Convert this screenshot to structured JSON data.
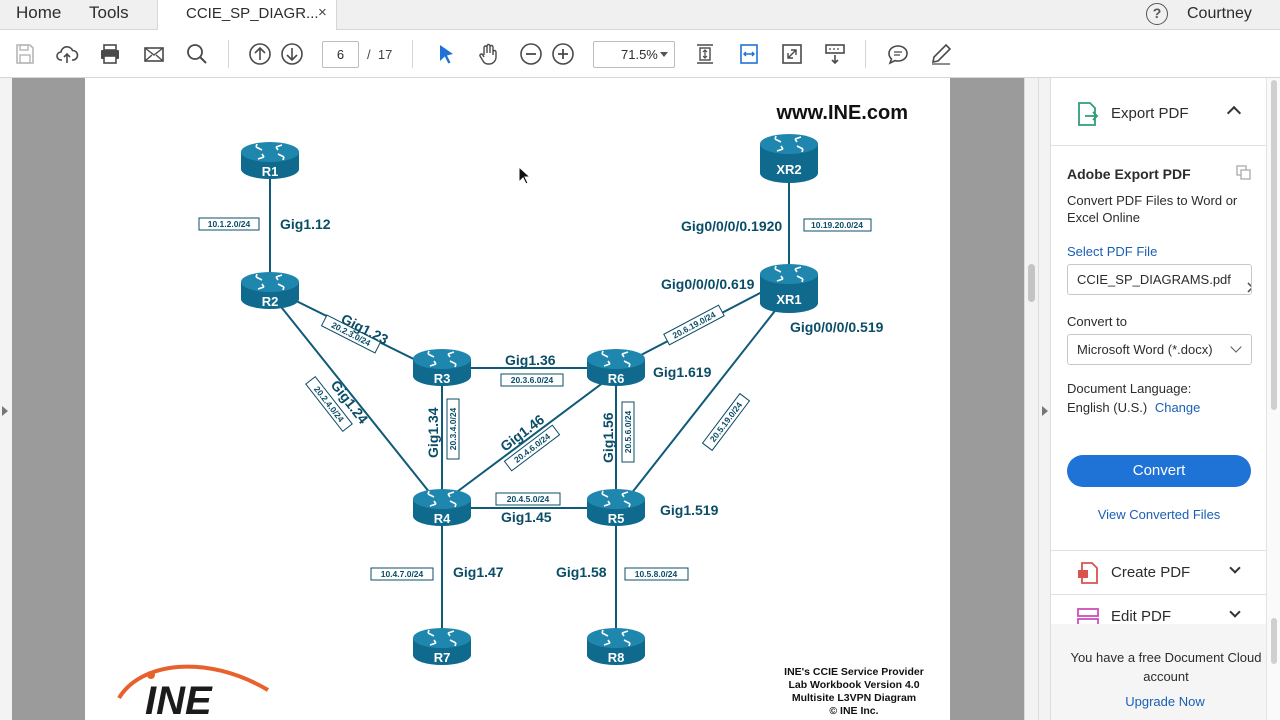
{
  "tabs": {
    "home": "Home",
    "tools": "Tools",
    "document": "CCIE_SP_DIAGR...",
    "close": "×"
  },
  "user": {
    "name": "Courtney",
    "help": "?"
  },
  "toolbar": {
    "page_current": "6",
    "page_separator": "/",
    "page_total": "17",
    "zoom": "71.5%"
  },
  "diagram": {
    "watermark": "www.INE.com",
    "routers": {
      "R1": "R1",
      "R2": "R2",
      "R3": "R3",
      "R4": "R4",
      "R5": "R5",
      "R6": "R6",
      "R7": "R7",
      "R8": "R8",
      "XR1": "XR1",
      "XR2": "XR2"
    },
    "interfaces": {
      "r1_r2": "Gig1.12",
      "r2_r3": "Gig1.23",
      "r2_r4": "Gig1.24",
      "r3_r6": "Gig1.36",
      "r3_r4": "Gig1.34",
      "r4_r6": "Gig1.46",
      "r6_r5": "Gig1.56",
      "r4_r5": "Gig1.45",
      "r4_r7": "Gig1.47",
      "r5_r8": "Gig1.58",
      "r6_xr1": "Gig1.619",
      "r5_xr1": "Gig1.519",
      "xr2_xr1": "Gig0/0/0/0.1920",
      "xr1_to_r6": "Gig0/0/0/0.619",
      "xr1_to_r5": "Gig0/0/0/0.519"
    },
    "subnets": {
      "r1_r2": "10.1.2.0/24",
      "r2_r3": "20.2.3.0/24",
      "r2_r4": "20.2.4.0/24",
      "r3_r6": "20.3.6.0/24",
      "r3_r4": "20.3.4.0/24",
      "r4_r6": "20.4.6.0/24",
      "r6_r5": "20.5.6.0/24",
      "r4_r5": "20.4.5.0/24",
      "r4_r7": "10.4.7.0/24",
      "r5_r8": "10.5.8.0/24",
      "r6_xr1": "20.6.19.0/24",
      "r5_xr1": "20.5.19.0/24",
      "xr2_xr1": "10.19.20.0/24"
    },
    "logo": "INE",
    "caption": [
      "INE's CCIE Service Provider",
      "Lab Workbook Version 4.0",
      "Multisite L3VPN Diagram",
      "© INE Inc."
    ]
  },
  "panel": {
    "export_title": "Export PDF",
    "adobe_export": "Adobe Export PDF",
    "convert_desc": "Convert PDF Files to Word or Excel Online",
    "select_file": "Select PDF File",
    "file_name": "CCIE_SP_DIAGRAMS.pdf",
    "convert_to": "Convert to",
    "format": "Microsoft Word (*.docx)",
    "doc_language_label": "Document Language:",
    "doc_language_value": "English (U.S.)",
    "change": "Change",
    "convert_button": "Convert",
    "view_converted": "View Converted Files",
    "create_pdf": "Create PDF",
    "edit_pdf": "Edit PDF",
    "promo": "You have a free Document Cloud account",
    "upgrade": "Upgrade Now"
  },
  "colors": {
    "router": "#0f6a8e",
    "router_top": "#1f87ae",
    "label": "#0b4d67",
    "accent_blue": "#1f73d6",
    "logo_orange": "#e8612c"
  }
}
